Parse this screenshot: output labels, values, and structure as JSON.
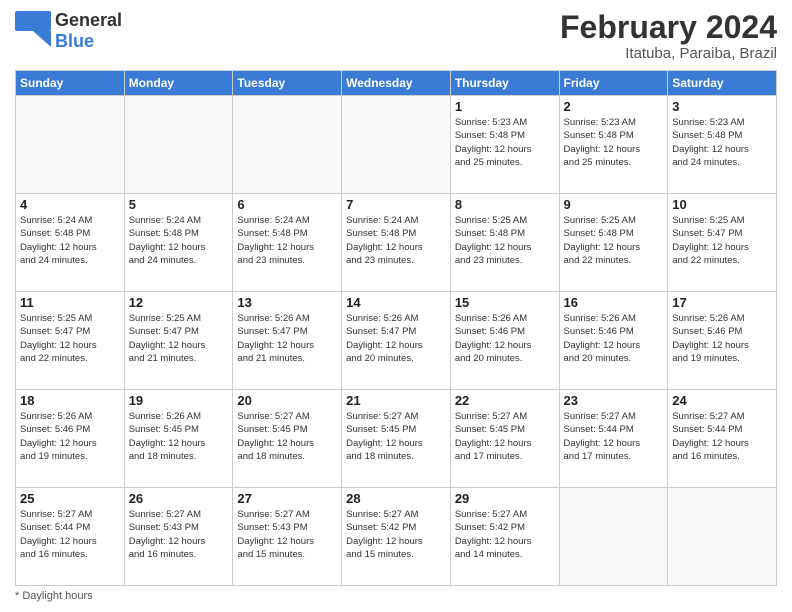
{
  "header": {
    "logo_general": "General",
    "logo_blue": "Blue",
    "month_year": "February 2024",
    "location": "Itatuba, Paraiba, Brazil"
  },
  "weekdays": [
    "Sunday",
    "Monday",
    "Tuesday",
    "Wednesday",
    "Thursday",
    "Friday",
    "Saturday"
  ],
  "weeks": [
    [
      {
        "day": "",
        "info": ""
      },
      {
        "day": "",
        "info": ""
      },
      {
        "day": "",
        "info": ""
      },
      {
        "day": "",
        "info": ""
      },
      {
        "day": "1",
        "info": "Sunrise: 5:23 AM\nSunset: 5:48 PM\nDaylight: 12 hours\nand 25 minutes."
      },
      {
        "day": "2",
        "info": "Sunrise: 5:23 AM\nSunset: 5:48 PM\nDaylight: 12 hours\nand 25 minutes."
      },
      {
        "day": "3",
        "info": "Sunrise: 5:23 AM\nSunset: 5:48 PM\nDaylight: 12 hours\nand 24 minutes."
      }
    ],
    [
      {
        "day": "4",
        "info": "Sunrise: 5:24 AM\nSunset: 5:48 PM\nDaylight: 12 hours\nand 24 minutes."
      },
      {
        "day": "5",
        "info": "Sunrise: 5:24 AM\nSunset: 5:48 PM\nDaylight: 12 hours\nand 24 minutes."
      },
      {
        "day": "6",
        "info": "Sunrise: 5:24 AM\nSunset: 5:48 PM\nDaylight: 12 hours\nand 23 minutes."
      },
      {
        "day": "7",
        "info": "Sunrise: 5:24 AM\nSunset: 5:48 PM\nDaylight: 12 hours\nand 23 minutes."
      },
      {
        "day": "8",
        "info": "Sunrise: 5:25 AM\nSunset: 5:48 PM\nDaylight: 12 hours\nand 23 minutes."
      },
      {
        "day": "9",
        "info": "Sunrise: 5:25 AM\nSunset: 5:48 PM\nDaylight: 12 hours\nand 22 minutes."
      },
      {
        "day": "10",
        "info": "Sunrise: 5:25 AM\nSunset: 5:47 PM\nDaylight: 12 hours\nand 22 minutes."
      }
    ],
    [
      {
        "day": "11",
        "info": "Sunrise: 5:25 AM\nSunset: 5:47 PM\nDaylight: 12 hours\nand 22 minutes."
      },
      {
        "day": "12",
        "info": "Sunrise: 5:25 AM\nSunset: 5:47 PM\nDaylight: 12 hours\nand 21 minutes."
      },
      {
        "day": "13",
        "info": "Sunrise: 5:26 AM\nSunset: 5:47 PM\nDaylight: 12 hours\nand 21 minutes."
      },
      {
        "day": "14",
        "info": "Sunrise: 5:26 AM\nSunset: 5:47 PM\nDaylight: 12 hours\nand 20 minutes."
      },
      {
        "day": "15",
        "info": "Sunrise: 5:26 AM\nSunset: 5:46 PM\nDaylight: 12 hours\nand 20 minutes."
      },
      {
        "day": "16",
        "info": "Sunrise: 5:26 AM\nSunset: 5:46 PM\nDaylight: 12 hours\nand 20 minutes."
      },
      {
        "day": "17",
        "info": "Sunrise: 5:26 AM\nSunset: 5:46 PM\nDaylight: 12 hours\nand 19 minutes."
      }
    ],
    [
      {
        "day": "18",
        "info": "Sunrise: 5:26 AM\nSunset: 5:46 PM\nDaylight: 12 hours\nand 19 minutes."
      },
      {
        "day": "19",
        "info": "Sunrise: 5:26 AM\nSunset: 5:45 PM\nDaylight: 12 hours\nand 18 minutes."
      },
      {
        "day": "20",
        "info": "Sunrise: 5:27 AM\nSunset: 5:45 PM\nDaylight: 12 hours\nand 18 minutes."
      },
      {
        "day": "21",
        "info": "Sunrise: 5:27 AM\nSunset: 5:45 PM\nDaylight: 12 hours\nand 18 minutes."
      },
      {
        "day": "22",
        "info": "Sunrise: 5:27 AM\nSunset: 5:45 PM\nDaylight: 12 hours\nand 17 minutes."
      },
      {
        "day": "23",
        "info": "Sunrise: 5:27 AM\nSunset: 5:44 PM\nDaylight: 12 hours\nand 17 minutes."
      },
      {
        "day": "24",
        "info": "Sunrise: 5:27 AM\nSunset: 5:44 PM\nDaylight: 12 hours\nand 16 minutes."
      }
    ],
    [
      {
        "day": "25",
        "info": "Sunrise: 5:27 AM\nSunset: 5:44 PM\nDaylight: 12 hours\nand 16 minutes."
      },
      {
        "day": "26",
        "info": "Sunrise: 5:27 AM\nSunset: 5:43 PM\nDaylight: 12 hours\nand 16 minutes."
      },
      {
        "day": "27",
        "info": "Sunrise: 5:27 AM\nSunset: 5:43 PM\nDaylight: 12 hours\nand 15 minutes."
      },
      {
        "day": "28",
        "info": "Sunrise: 5:27 AM\nSunset: 5:42 PM\nDaylight: 12 hours\nand 15 minutes."
      },
      {
        "day": "29",
        "info": "Sunrise: 5:27 AM\nSunset: 5:42 PM\nDaylight: 12 hours\nand 14 minutes."
      },
      {
        "day": "",
        "info": ""
      },
      {
        "day": "",
        "info": ""
      }
    ]
  ],
  "footer": {
    "daylight_label": "Daylight hours"
  }
}
